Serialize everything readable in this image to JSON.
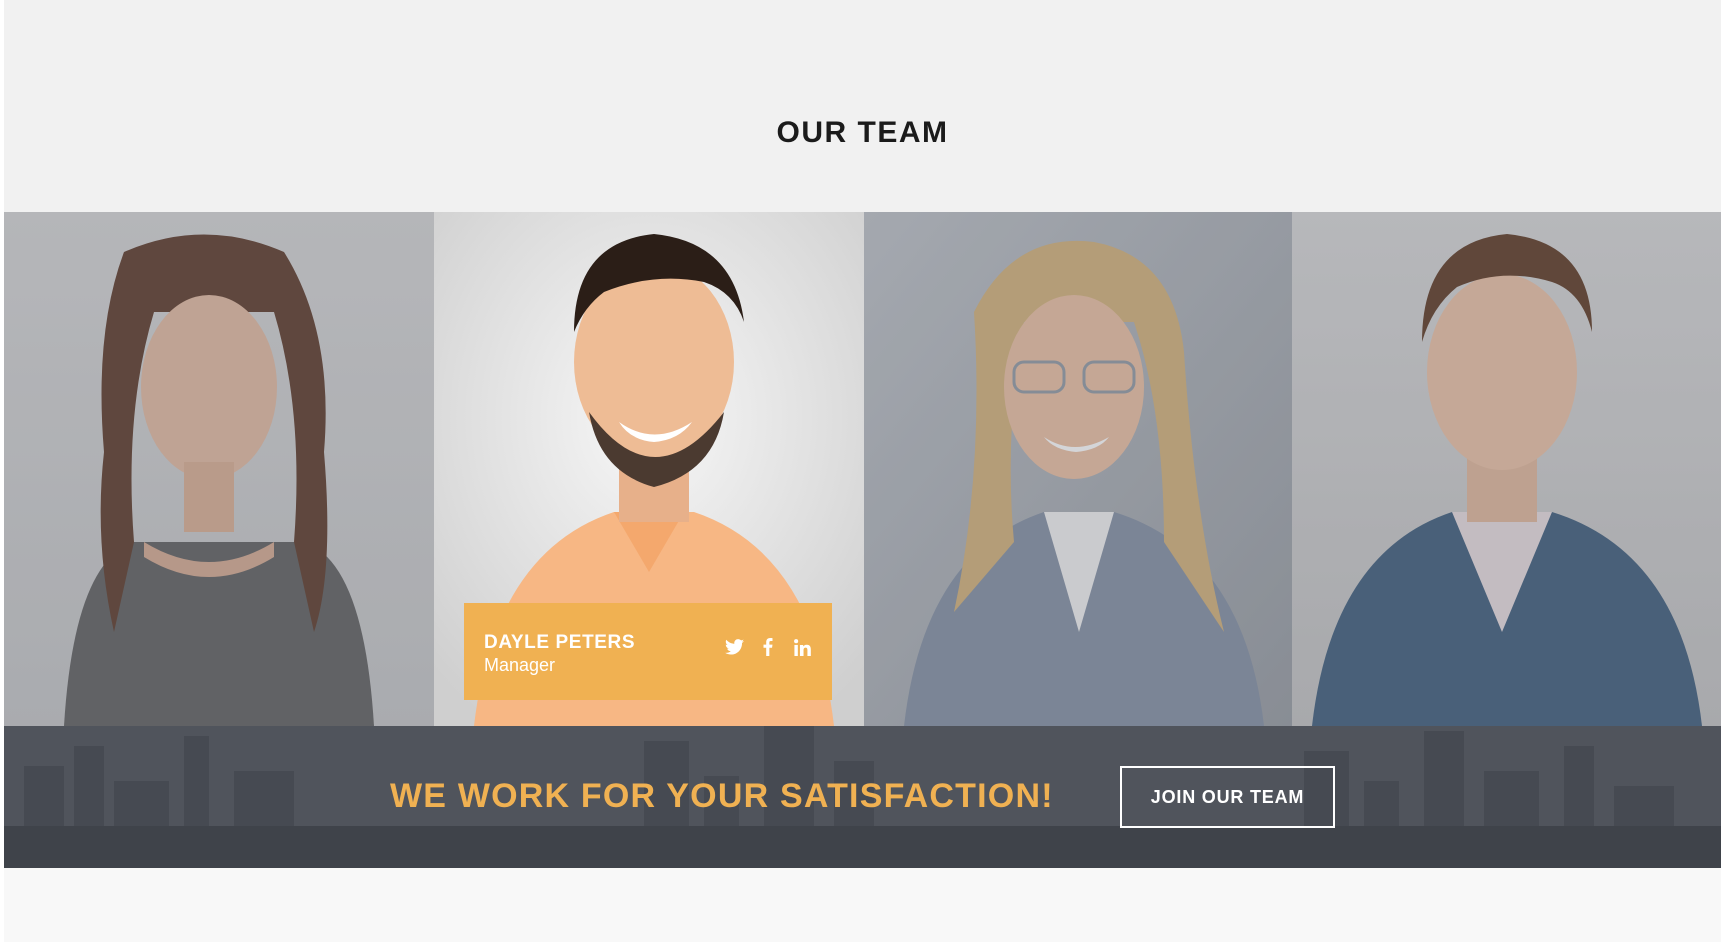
{
  "section": {
    "title": "OUR TEAM"
  },
  "team": {
    "featured": {
      "name": "DAYLE PETERS",
      "role": "Manager",
      "social_icons": [
        "twitter-icon",
        "facebook-icon",
        "linkedin-icon"
      ]
    }
  },
  "cta": {
    "headline": "WE WORK FOR YOUR SATISFACTION!",
    "button_label": "JOIN OUR TEAM"
  },
  "colors": {
    "accent": "#f0b152",
    "title_text": "#1b1b1b",
    "band_background": "#51555d"
  }
}
